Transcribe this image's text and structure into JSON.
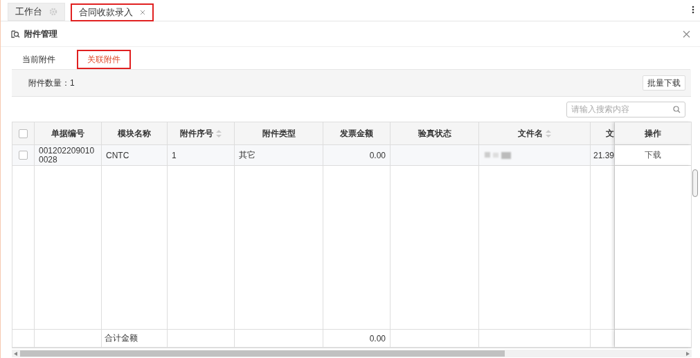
{
  "tabs": [
    {
      "label": "工作台",
      "selected": false,
      "closable": false
    },
    {
      "label": "合同收款录入",
      "selected": true,
      "closable": true
    }
  ],
  "panel": {
    "title": "附件管理",
    "tabs": [
      {
        "label": "当前附件",
        "selected": false
      },
      {
        "label": "关联附件",
        "selected": true
      }
    ],
    "count_label": "附件数量：1",
    "batch_button": "批量下载",
    "search": {
      "placeholder": "请输入搜索内容"
    },
    "table": {
      "all_checked": false,
      "columns": [
        {
          "label": "单据编号",
          "sortable": false
        },
        {
          "label": "模块名称",
          "sortable": false
        },
        {
          "label": "附件序号",
          "sortable": true
        },
        {
          "label": "附件类型",
          "sortable": false
        },
        {
          "label": "发票金额",
          "sortable": false
        },
        {
          "label": "验真状态",
          "sortable": false
        },
        {
          "label": "文件名",
          "sortable": true
        },
        {
          "label": "文",
          "sortable": false
        },
        {
          "label": "操作",
          "sortable": false
        }
      ],
      "rows": [
        {
          "checked": false,
          "bill_no": "0012022090100028",
          "module": "CNTC",
          "seq": "1",
          "type": "其它",
          "amount": "0.00",
          "size": "21.39",
          "action": "下载"
        }
      ],
      "footer": {
        "label": "合计金额",
        "amount": "0.00"
      }
    }
  }
}
